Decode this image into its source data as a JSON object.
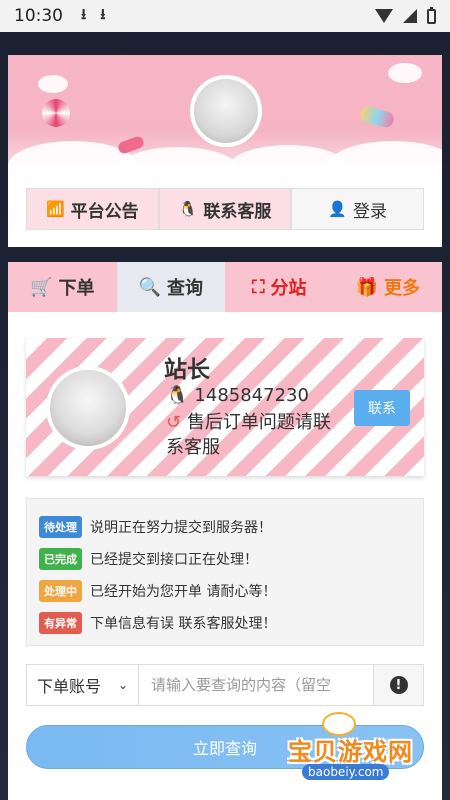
{
  "status_bar": {
    "time": "10:30"
  },
  "top_nav": {
    "announcement_label": "平台公告",
    "service_label": "联系客服",
    "login_label": "登录"
  },
  "tabs": [
    {
      "label": "下单"
    },
    {
      "label": "查询"
    },
    {
      "label": "分站"
    },
    {
      "label": "更多"
    }
  ],
  "admin": {
    "name": "站长",
    "qq": "1485847230",
    "note": "售后订单问题请联系客服",
    "contact_label": "联系"
  },
  "statuses": [
    {
      "badge": "待处理",
      "text": "说明正在努力提交到服务器！",
      "color": "#3c8ad8"
    },
    {
      "badge": "已完成",
      "text": "已经提交到接口正在处理！",
      "color": "#3fb24b"
    },
    {
      "badge": "处理中",
      "text": "已经开始为您开单 请耐心等！",
      "color": "#f0a640"
    },
    {
      "badge": "有异常",
      "text": "下单信息有误 联系客服处理！",
      "color": "#e35d4e"
    }
  ],
  "search": {
    "select_value": "下单账号",
    "placeholder": "请输入要查询的内容（留空"
  },
  "query_button": "立即查询",
  "watermark": {
    "title": "宝贝游戏网",
    "site": "baobeiy.com"
  },
  "colors": {
    "pink": "#f7b6c5",
    "blue": "#5aaef0"
  }
}
